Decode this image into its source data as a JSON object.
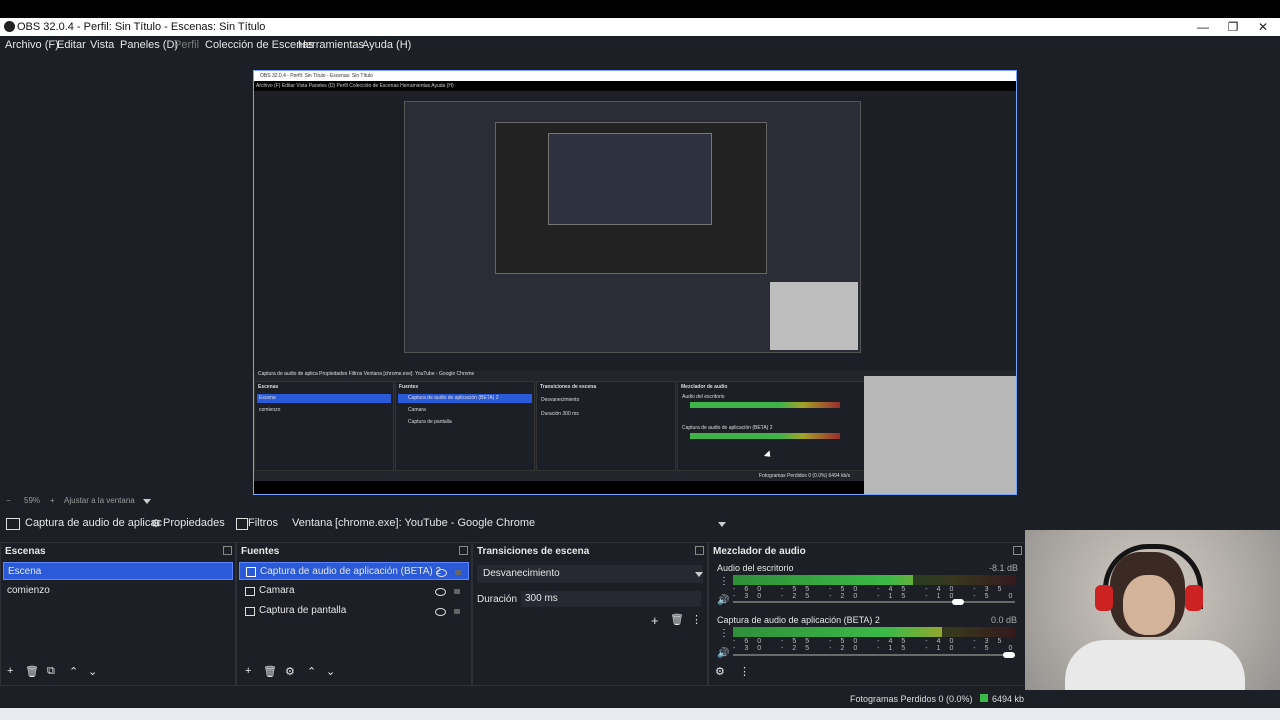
{
  "window": {
    "title": "OBS 32.0.4 - Perfil: Sin Título - Escenas: Sin Título",
    "controls": [
      "—",
      "❐",
      "✕"
    ]
  },
  "menu": [
    "Archivo (F)",
    "Editar",
    "Vista",
    "Paneles (D)",
    "Perfil",
    "Colección de Escenas",
    "Herramientas",
    "Ayuda (H)"
  ],
  "zoom": {
    "minus": "−",
    "value": "59%",
    "plus": "+",
    "fit": "Ajustar a la ventana"
  },
  "toolbar": {
    "source": "Captura de audio de aplicac",
    "properties": "Propiedades",
    "filters": "Filtros",
    "window_label": "Ventana",
    "window_value": "[chrome.exe]: YouTube - Google Chrome"
  },
  "scenes": {
    "title": "Escenas",
    "items": [
      {
        "label": "Escena",
        "selected": true
      },
      {
        "label": "comienzo",
        "selected": false
      }
    ]
  },
  "sources": {
    "title": "Fuentes",
    "items": [
      {
        "label": "Captura de audio de aplicación (BETA) 2",
        "selected": true,
        "icon": "audio-capture-icon"
      },
      {
        "label": "Camara",
        "selected": false,
        "icon": "camera-icon"
      },
      {
        "label": "Captura de pantalla",
        "selected": false,
        "icon": "monitor-icon"
      }
    ]
  },
  "transitions": {
    "title": "Transiciones de escena",
    "type": "Desvanecimiento",
    "duration_label": "Duración",
    "duration_value": "300 ms"
  },
  "mixer": {
    "title": "Mezclador de audio",
    "channels": [
      {
        "name": "Audio del escritorio",
        "db": "-8.1 dB",
        "level": 0.64,
        "volume": 0.82
      },
      {
        "name": "Captura de audio de aplicación (BETA) 2",
        "db": "0.0 dB",
        "level": 0.74,
        "volume": 1.0
      }
    ],
    "ticks": "-60 -55 -50 -45 -40 -35 -30 -25 -20 -15 -10 -5 0"
  },
  "status": {
    "dropped": "Fotogramas Perdidos 0 (0.0%)",
    "bitrate": "6494 kb"
  },
  "nested": {
    "title": "OBS 32.0.4 - Perfil: Sin Título - Escenas: Sin Título",
    "menu": "Archivo (F)   Editar   Vista   Paneles (D)   Perfil   Colección de Escenas   Herramientas   Ayuda (H)",
    "toolbar": "Captura de audio de aplica   Propiedades   Filtros   Ventana   [chrome.exe]: YouTube - Google Chrome",
    "scenes_h": "Escenas",
    "scene1": "Escena",
    "scene2": "comienzo",
    "sources_h": "Fuentes",
    "src1": "Captura de audio de aplicación (BETA) 2",
    "src2": "Camara",
    "src3": "Captura de pantalla",
    "trans_h": "Transiciones de escena",
    "trans_type": "Desvanecimiento",
    "trans_dur": "Duración   300 ms",
    "mixer_h": "Mezclador de audio",
    "mix1": "Audio del escritorio",
    "mix2": "Captura de audio de aplicación (BETA) 2",
    "status": "Fotogramas Perdidos 0 (0.0%)   6494 kb/s"
  }
}
